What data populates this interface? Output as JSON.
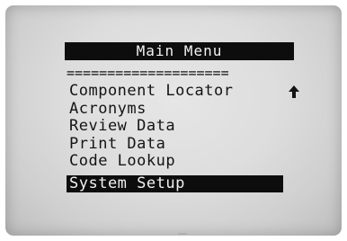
{
  "title": "Main Menu",
  "separator": "====================",
  "menu": {
    "items": [
      {
        "label": "Component Locator"
      },
      {
        "label": "Acronyms"
      },
      {
        "label": "Review Data"
      },
      {
        "label": "Print Data"
      },
      {
        "label": "Code Lookup"
      },
      {
        "label": "System Setup"
      }
    ],
    "selected_label": "System Setup"
  },
  "scroll_indicator": {
    "icon": "up-arrow-icon"
  },
  "colors": {
    "lcd_background": "#dddddd",
    "lcd_text": "#141414",
    "highlight_background": "#0d0d0d",
    "highlight_text": "#f2f2f2"
  }
}
